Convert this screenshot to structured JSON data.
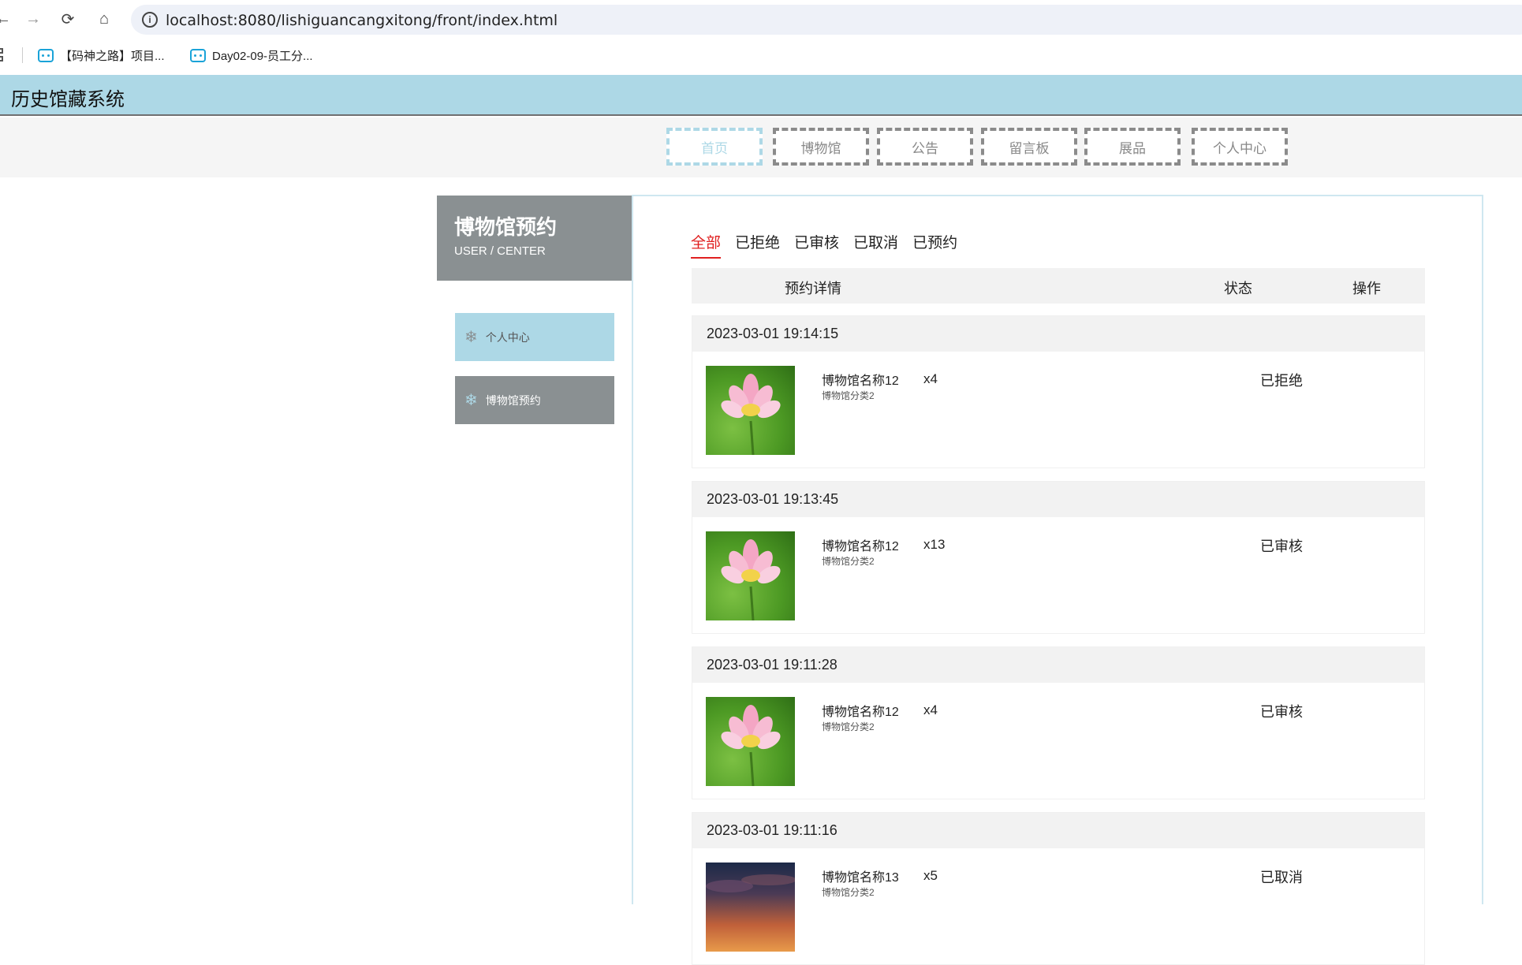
{
  "browser": {
    "url": "localhost:8080/lishiguancangxitong/front/index.html",
    "bookmarks": [
      {
        "label": "【码神之路】项目..."
      },
      {
        "label": "Day02-09-员工分..."
      }
    ]
  },
  "site": {
    "title": "历史馆藏系统",
    "nav": [
      {
        "label": "首页",
        "active": true
      },
      {
        "label": "博物馆",
        "active": false
      },
      {
        "label": "公告",
        "active": false
      },
      {
        "label": "留言板",
        "active": false
      },
      {
        "label": "展品",
        "active": false
      },
      {
        "label": "个人中心",
        "active": false
      }
    ],
    "colors": {
      "accent": "#add8e6",
      "sidebar_gray": "#8a9092",
      "active_tab": "#e02020"
    }
  },
  "sidebar": {
    "title": "博物馆预约",
    "subtitle": "USER / CENTER",
    "items": [
      {
        "label": "个人中心",
        "icon": "snowflake-icon"
      },
      {
        "label": "博物馆预约",
        "icon": "snowflake-icon"
      }
    ]
  },
  "main": {
    "tabs": [
      {
        "label": "全部",
        "active": true
      },
      {
        "label": "已拒绝",
        "active": false
      },
      {
        "label": "已审核",
        "active": false
      },
      {
        "label": "已取消",
        "active": false
      },
      {
        "label": "已预约",
        "active": false
      }
    ],
    "columns": {
      "detail": "预约详情",
      "status": "状态",
      "action": "操作"
    },
    "orders": [
      {
        "time": "2023-03-01 19:14:15",
        "name": "博物馆名称12",
        "category": "博物馆分类2",
        "qty": "x4",
        "status": "已拒绝",
        "image": "lotus"
      },
      {
        "time": "2023-03-01 19:13:45",
        "name": "博物馆名称12",
        "category": "博物馆分类2",
        "qty": "x13",
        "status": "已审核",
        "image": "lotus"
      },
      {
        "time": "2023-03-01 19:11:28",
        "name": "博物馆名称12",
        "category": "博物馆分类2",
        "qty": "x4",
        "status": "已审核",
        "image": "lotus"
      },
      {
        "time": "2023-03-01 19:11:16",
        "name": "博物馆名称13",
        "category": "博物馆分类2",
        "qty": "x5",
        "status": "已取消",
        "image": "sunset"
      }
    ]
  }
}
